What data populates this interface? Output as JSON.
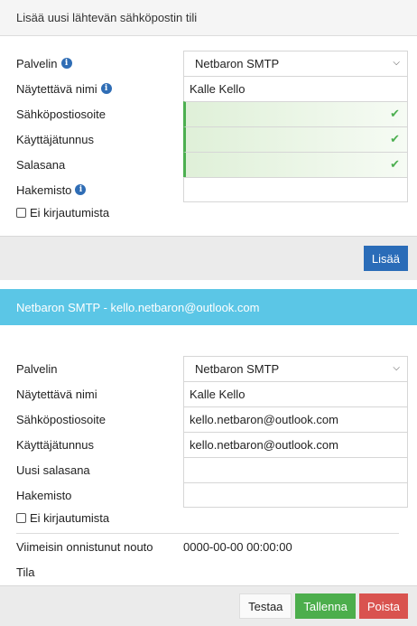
{
  "new_account": {
    "title": "Lisää uusi lähtevän sähköpostin tili",
    "server_label": "Palvelin",
    "server_value": "Netbaron SMTP",
    "display_name_label": "Näytettävä nimi",
    "display_name_value": "Kalle Kello",
    "email_label": "Sähköpostiosoite",
    "username_label": "Käyttäjätunnus",
    "password_label": "Salasana",
    "directory_label": "Hakemisto",
    "no_login_label": "Ei kirjautumista",
    "add_button": "Lisää"
  },
  "account": {
    "header": "Netbaron SMTP - kello.netbaron@outlook.com",
    "server_label": "Palvelin",
    "server_value": "Netbaron SMTP",
    "display_name_label": "Näytettävä nimi",
    "display_name_value": "Kalle Kello",
    "email_label": "Sähköpostiosoite",
    "email_value": "kello.netbaron@outlook.com",
    "username_label": "Käyttäjätunnus",
    "username_value": "kello.netbaron@outlook.com",
    "new_password_label": "Uusi salasana",
    "directory_label": "Hakemisto",
    "no_login_label": "Ei kirjautumista",
    "last_fetch_label": "Viimeisin onnistunut nouto",
    "last_fetch_value": "0000-00-00 00:00:00",
    "status_label": "Tila",
    "test_button": "Testaa",
    "save_button": "Tallenna",
    "delete_button": "Poista"
  },
  "icons": {
    "info": "info-icon",
    "check": "check-icon",
    "chevron": "chevron-down-icon"
  },
  "colors": {
    "accent_blue": "#2a6cb8",
    "header_cyan": "#5bc6e6",
    "valid_green": "#4caf50",
    "save_green": "#4cae4c",
    "delete_red": "#d9534f"
  }
}
